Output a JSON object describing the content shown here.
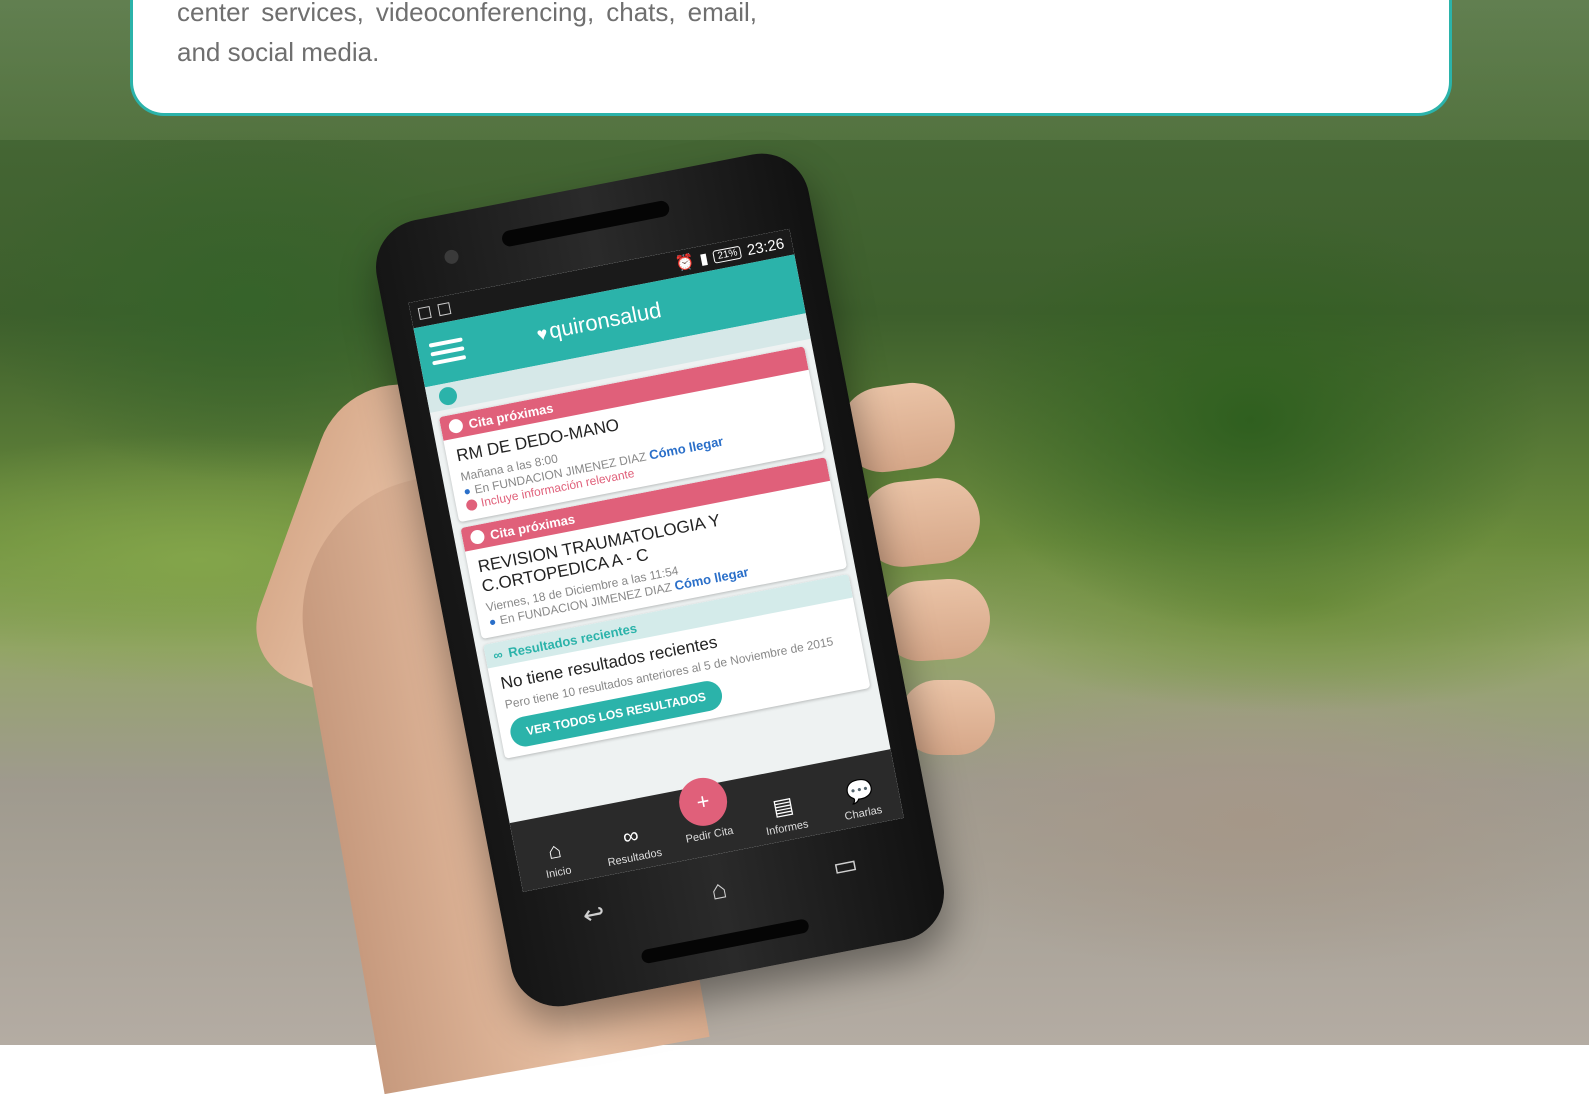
{
  "info": {
    "text": "center services, videoconferencing, chats, email, and social media."
  },
  "statusbar": {
    "battery": "21%",
    "time": "23:26"
  },
  "app": {
    "logo": "quironsalud",
    "accent": "#2bb3aa",
    "alert": "#e0607a"
  },
  "cards": [
    {
      "header": "Cita próximas",
      "title": "RM DE DEDO-MANO",
      "when": "Mañana a las 8:00",
      "location": "En FUNDACION JIMENEZ DIAZ",
      "link": "Cómo llegar",
      "note": "Incluye información relevante"
    },
    {
      "header": "Cita próximas",
      "title": "REVISION TRAUMATOLOGIA Y C.ORTOPEDICA A - C",
      "when": "Viernes, 18 de Diciembre a las 11:54",
      "location": "En FUNDACION JIMENEZ DIAZ",
      "link": "Cómo llegar"
    }
  ],
  "results": {
    "header": "Resultados recientes",
    "title": "No tiene resultados recientes",
    "sub": "Pero tiene 10 resultados anteriores al 5 de Noviembre de 2015",
    "button": "VER TODOS LOS RESULTADOS"
  },
  "nav": [
    {
      "label": "Inicio",
      "icon": "home-icon"
    },
    {
      "label": "Resultados",
      "icon": "results-icon"
    },
    {
      "label": "Pedir Cita",
      "icon": "add-appointment-icon"
    },
    {
      "label": "Informes",
      "icon": "reports-icon"
    },
    {
      "label": "Charlas",
      "icon": "chat-icon"
    }
  ]
}
